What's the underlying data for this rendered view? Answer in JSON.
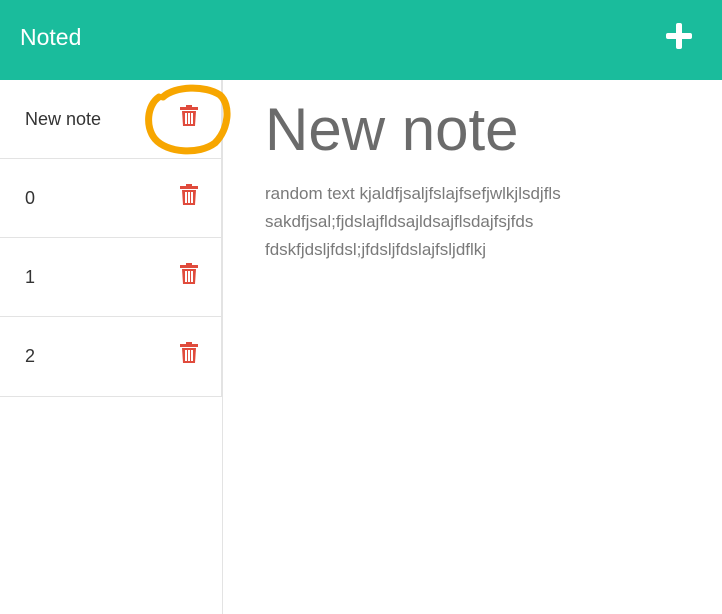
{
  "app": {
    "title": "Noted"
  },
  "header": {
    "add_icon": "plus-icon"
  },
  "notes": [
    {
      "title": "New note",
      "delete_icon": "trash-icon"
    },
    {
      "title": "0",
      "delete_icon": "trash-icon"
    },
    {
      "title": "1",
      "delete_icon": "trash-icon"
    },
    {
      "title": "2",
      "delete_icon": "trash-icon"
    }
  ],
  "editor": {
    "title": "New note",
    "body_lines": [
      "random text kjaldfjsaljfslajfsefjwlkjlsdjfls",
      "sakdfjsal;fjdslajfldsajldsajflsdajfsjfds",
      "fdskfjdsljfdsl;jfdsljfdslajfsljdflkj"
    ]
  },
  "colors": {
    "header": "#1abc9c",
    "trash": "#e04b3c",
    "highlight": "#f7a600"
  }
}
